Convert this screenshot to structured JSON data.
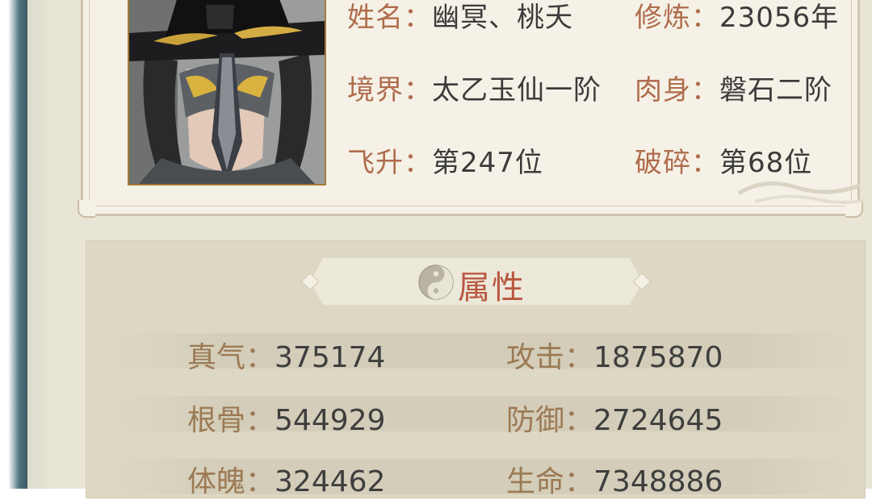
{
  "profile": {
    "portrait": "character-portrait",
    "rows": [
      {
        "label1": "姓名",
        "value1": "幽冥、桃夭",
        "label2": "修炼",
        "value2": "23056年"
      },
      {
        "label1": "境界",
        "value1": "太乙玉仙一阶",
        "label2": "肉身",
        "value2": "磐石二阶"
      },
      {
        "label1": "飞升",
        "value1": "第247位",
        "label2": "破碎",
        "value2": "第68位"
      }
    ]
  },
  "attributes": {
    "title": "属性",
    "title_icon": "taiji-icon",
    "rows": [
      {
        "label1": "真气",
        "value1": "375174",
        "label2": "攻击",
        "value2": "1875870"
      },
      {
        "label1": "根骨",
        "value1": "544929",
        "label2": "防御",
        "value2": "2724645"
      },
      {
        "label1": "体魄",
        "value1": "324462",
        "label2": "生命",
        "value2": "7348886"
      }
    ]
  },
  "colors": {
    "label": "#b06c4d",
    "attr_label": "#9c7a55",
    "value": "#3b3b3b",
    "title": "#b8573f",
    "panel": "#e9e5d6"
  }
}
